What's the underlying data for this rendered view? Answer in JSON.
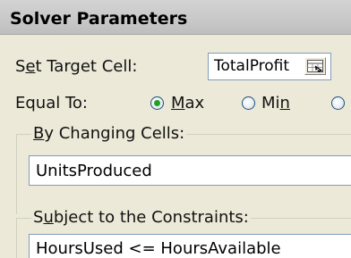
{
  "window": {
    "title": "Solver Parameters"
  },
  "target": {
    "label_pre": "S",
    "label_ul": "e",
    "label_post": "t Target Cell:",
    "value": "TotalProfit",
    "collapse_icon": "collapse-dialog-icon"
  },
  "equal_to": {
    "label": "Equal To:",
    "options": [
      {
        "label_ul": "M",
        "label_post": "ax",
        "selected": true
      },
      {
        "label_pre": "Mi",
        "label_ul": "n",
        "selected": false
      }
    ],
    "selected_color": "#21a121"
  },
  "changing_cells": {
    "label_ul": "B",
    "label_post": "y Changing Cells:",
    "value": "UnitsProduced"
  },
  "constraints": {
    "label_pre": "S",
    "label_ul": "u",
    "label_post": "bject to the Constraints:",
    "items": [
      "HoursUsed <= HoursAvailable"
    ]
  }
}
